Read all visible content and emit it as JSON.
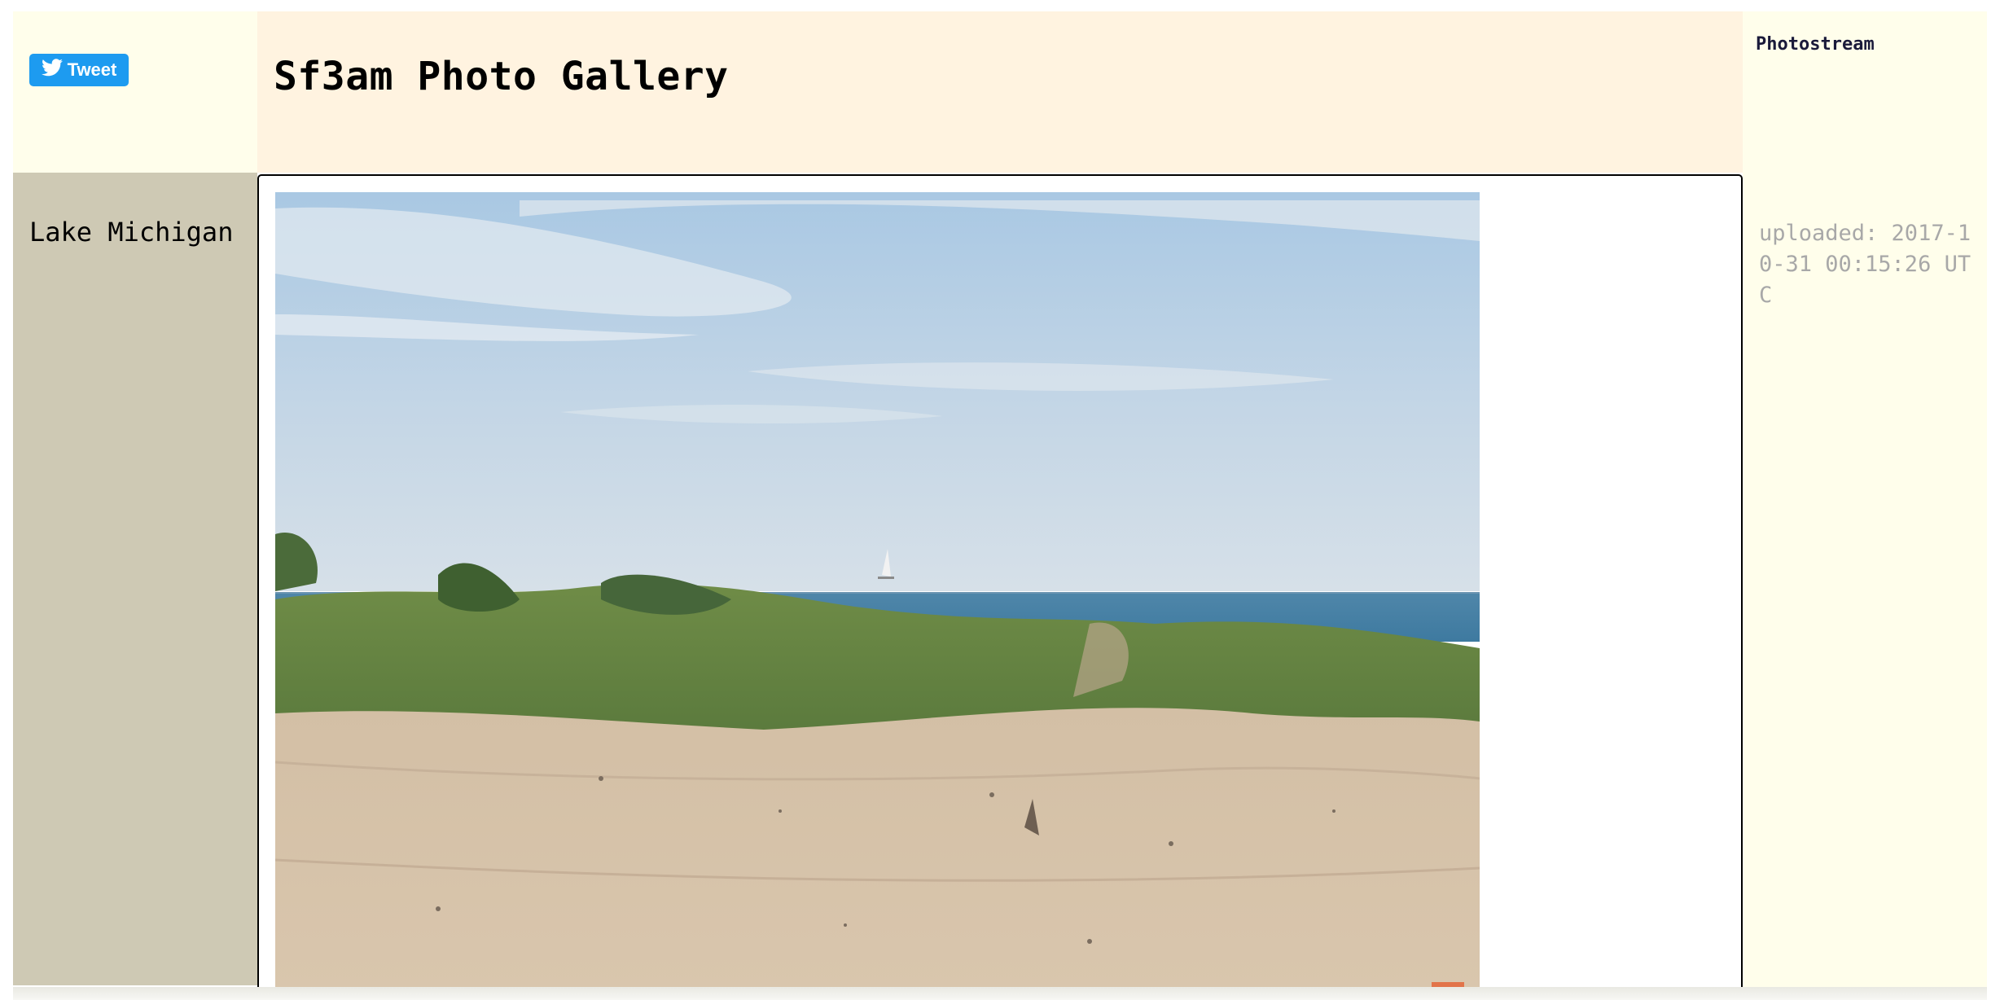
{
  "header": {
    "title": "Sf3am Photo Gallery",
    "tweet_label": "Tweet",
    "photostream_link": "Photostream"
  },
  "photo": {
    "title": "Lake Michigan",
    "uploaded": "uploaded: 2017-10-31 00:15:26 UTC",
    "alt": "Lake Michigan"
  },
  "colors": {
    "tweet_button": "#1d9bf0",
    "header_bg": "#fff3e0",
    "sidebar_left": "#cec9b4",
    "sidebar_right": "#fffeeb"
  },
  "icons": {
    "tweet": "twitter-bird-icon"
  }
}
